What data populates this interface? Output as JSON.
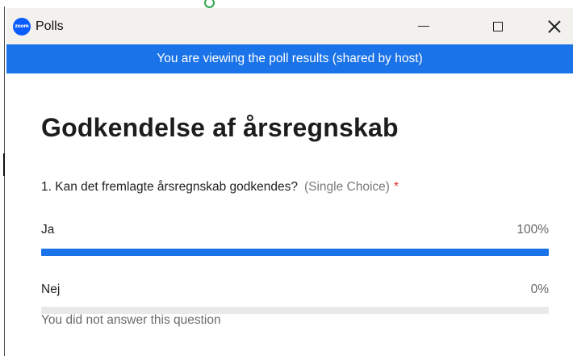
{
  "window": {
    "title": "Polls",
    "app_icon_text": "zoom",
    "controls": {
      "minimize_icon": "minimize-icon",
      "maximize_icon": "maximize-icon",
      "close_icon": "close-icon"
    }
  },
  "banner": {
    "text": "You are viewing the poll results (shared by host)",
    "color": "#1a73e8"
  },
  "poll": {
    "title": "Godkendelse af årsregnskab",
    "question": {
      "text": "1. Kan det fremlagte årsregnskab godkendes?",
      "type": "(Single Choice)",
      "required_mark": "*"
    },
    "options": [
      {
        "label": "Ja",
        "percent_text": "100%",
        "fraction": 1.0
      },
      {
        "label": "Nej",
        "percent_text": "0%",
        "fraction": 0.0
      }
    ],
    "footnote": "You did not answer this question"
  },
  "colors": {
    "accent": "#1a73e8",
    "bar_track": "#e9e9ec",
    "required": "#e02828"
  }
}
